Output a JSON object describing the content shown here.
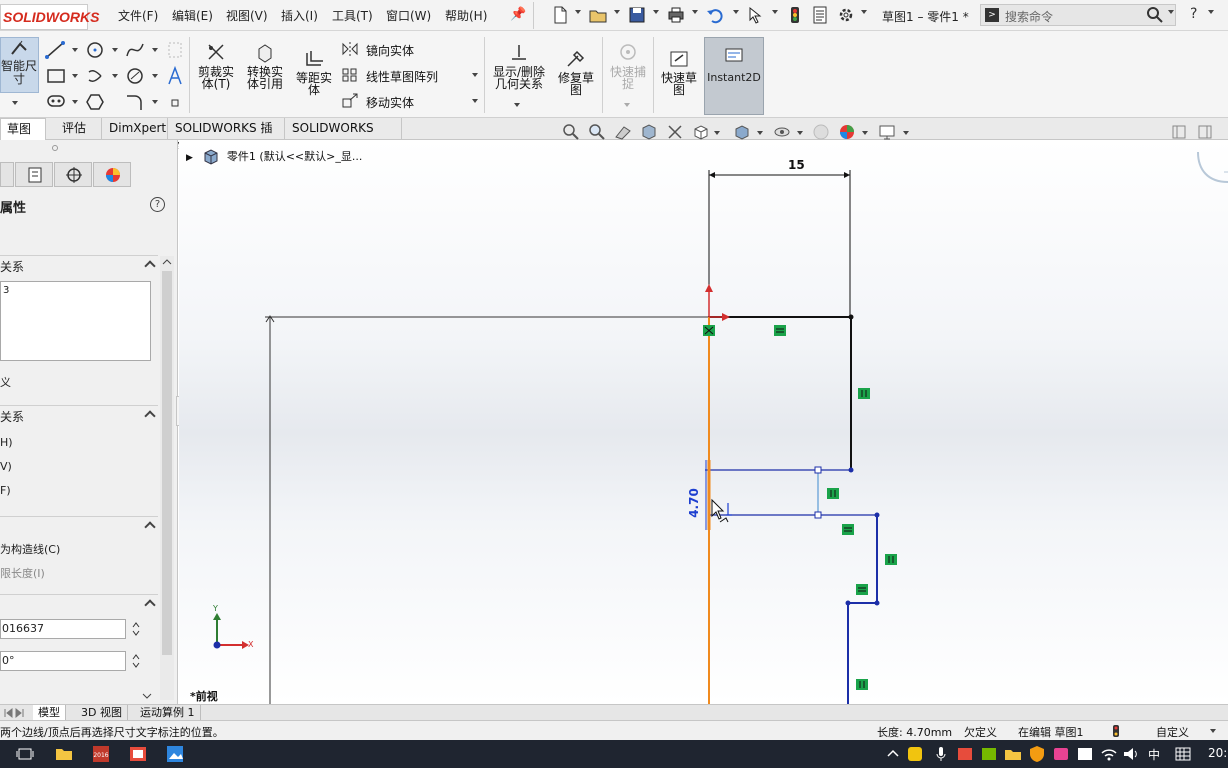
{
  "app": {
    "logo": "SOLIDWORKS",
    "menu": [
      "文件(F)",
      "编辑(E)",
      "视图(V)",
      "插入(I)",
      "工具(T)",
      "窗口(W)",
      "帮助(H)"
    ],
    "doc_title": "草图1 – 零件1 *",
    "search_placeholder": "搜索命令",
    "help": "?"
  },
  "ribbon": {
    "smart_dim": "智能尺寸",
    "trim": "剪裁实体(T)",
    "convert": "转换实体引用",
    "offset": "等距实体",
    "mirror": "镜向实体",
    "linear_pattern": "线性草图阵列",
    "move": "移动实体",
    "show_delete": "显示/删除几何关系",
    "repair": "修复草图",
    "quick_snap": "快速捕捉",
    "rapid_sketch": "快速草图",
    "instant2d": "Instant2D"
  },
  "cmd_tabs": [
    "草图",
    "评估",
    "DimXpert",
    "SOLIDWORKS 插件",
    "SOLIDWORKS MBD"
  ],
  "panel": {
    "title": "属性",
    "section_relations": "关系",
    "relation_item": "3",
    "undefined_label": "义",
    "section_add_relations": "关系",
    "add_rel_items": [
      "H)",
      "V)",
      "F)"
    ],
    "options": [
      "为构造线(C)",
      "限长度(I)"
    ],
    "param_length": "016637",
    "param_angle": "0°"
  },
  "tree": {
    "root": "零件1 (默认<<默认>_显..."
  },
  "sketch": {
    "dim_horizontal": "15",
    "dim_vertical": "4.70",
    "view_name": "*前视",
    "axis_x": "X",
    "axis_y": "Y"
  },
  "bottom_tabs": [
    "模型",
    "3D 视图",
    "运动算例 1"
  ],
  "status": {
    "message": "两个边线/顶点后再选择尺寸文字标注的位置。",
    "length": "长度: 4.70mm",
    "state": "欠定义",
    "editing": "在编辑 草图1",
    "units": "自定义"
  },
  "taskbar": {
    "ime": "中",
    "clock": "20:"
  },
  "colors": {
    "sketch_blue": "#1c2fa8",
    "sketch_black": "#111111",
    "selected_orange": "#f08a1e",
    "relation_green": "#1aa34a",
    "logo_red": "#d52b1e",
    "dimension_blue": "#1d3fd0"
  }
}
